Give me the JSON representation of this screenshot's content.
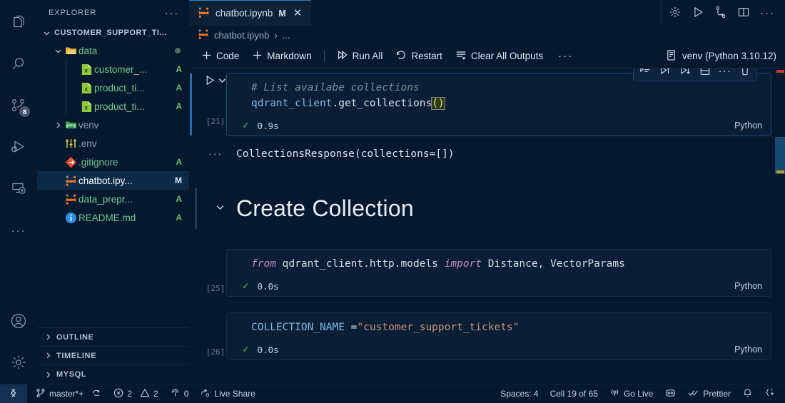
{
  "activitybar": {
    "items": [
      {
        "name": "explorer",
        "icon": "files-icon"
      },
      {
        "name": "search",
        "icon": "search-icon"
      },
      {
        "name": "source-control",
        "icon": "source-control-icon",
        "badge": "8"
      },
      {
        "name": "run-and-debug",
        "icon": "run-debug-icon"
      },
      {
        "name": "remote-explorer",
        "icon": "remote-explorer-icon"
      },
      {
        "name": "additional-views",
        "icon": "ellipsis-icon"
      }
    ],
    "bottom": [
      {
        "name": "accounts",
        "icon": "account-icon"
      },
      {
        "name": "manage",
        "icon": "gear-icon"
      }
    ]
  },
  "sidebar": {
    "title": "EXPLORER",
    "more_label": "···",
    "root_folder": "CUSTOMER_SUPPORT_TI...",
    "tree": [
      {
        "label": "data",
        "type": "folder",
        "indent": 1,
        "expanded": true,
        "status": "",
        "dot": true,
        "color": "green"
      },
      {
        "label": "customer_...",
        "type": "excel",
        "indent": 2,
        "status": "A",
        "color": "green"
      },
      {
        "label": "product_ti...",
        "type": "excel",
        "indent": 2,
        "status": "A",
        "color": "green"
      },
      {
        "label": "product_ti...",
        "type": "excel",
        "indent": 2,
        "status": "A",
        "color": "green"
      },
      {
        "label": "venv",
        "type": "folder",
        "indent": 1,
        "expanded": false,
        "status": "",
        "color": "dim"
      },
      {
        "label": ".env",
        "type": "env",
        "indent": 1,
        "status": "",
        "color": "dim"
      },
      {
        "label": ".gitignore",
        "type": "git",
        "indent": 1,
        "status": "A",
        "color": "green"
      },
      {
        "label": "chatbot.ipy...",
        "type": "notebook",
        "indent": 1,
        "status": "M",
        "color": "sel",
        "selected": true
      },
      {
        "label": "data_prepr...",
        "type": "notebook",
        "indent": 1,
        "status": "A",
        "color": "green"
      },
      {
        "label": "README.md",
        "type": "info",
        "indent": 1,
        "status": "A",
        "color": "green"
      }
    ],
    "sections": [
      {
        "label": "OUTLINE"
      },
      {
        "label": "TIMELINE"
      },
      {
        "label": "MYSQL"
      }
    ]
  },
  "editor": {
    "tab": {
      "title": "chatbot.ipynb",
      "dirty_marker": "M",
      "close": "✕",
      "icon": "jupyter-notebook-icon"
    },
    "tab_actions": [
      {
        "name": "settings-gear-icon"
      },
      {
        "name": "run-icon"
      },
      {
        "name": "compare-changes-icon"
      },
      {
        "name": "split-editor-icon"
      },
      {
        "name": "more-actions-icon",
        "label": "···"
      }
    ],
    "breadcrumbs": {
      "file": "chatbot.ipynb",
      "separator": "›",
      "more": "..."
    },
    "toolbar": {
      "code_label": "Code",
      "markdown_label": "Markdown",
      "run_all_label": "Run All",
      "restart_label": "Restart",
      "clear_all_outputs_label": "Clear All Outputs",
      "more_label": "···",
      "kernel_label": "venv (Python 3.10.12)"
    },
    "cell_toolbar": [
      {
        "name": "run-by-line-icon"
      },
      {
        "name": "execute-above-cells-icon"
      },
      {
        "name": "execute-cell-and-below-icon"
      },
      {
        "name": "split-cell-icon"
      },
      {
        "name": "more-actions-icon",
        "label": "···"
      },
      {
        "name": "delete-cell-icon"
      }
    ],
    "cells": [
      {
        "kind": "code",
        "exec_count": "[21]",
        "duration": "0.9s",
        "language": "Python",
        "status_icon": "success-check",
        "lines": [
          {
            "text": "# List availabe collections",
            "style": "comment"
          },
          {
            "text": "qdrant_client.get_collections()",
            "style": "call"
          }
        ],
        "output": "CollectionsResponse(collections=[])",
        "output_dots": "···"
      },
      {
        "kind": "markdown",
        "heading": "Create Collection",
        "twisty": "⌄"
      },
      {
        "kind": "code",
        "exec_count": "[25]",
        "duration": "0.0s",
        "language": "Python",
        "status_icon": "success-check",
        "lines": [
          {
            "text": "from qdrant_client.http.models import Distance, VectorParams",
            "style": "import"
          }
        ]
      },
      {
        "kind": "code",
        "exec_count": "[26]",
        "duration": "0.0s",
        "language": "Python",
        "status_icon": "success-check",
        "lines": [
          {
            "text": "COLLECTION_NAME =\"customer_support_tickets\"",
            "style": "assign"
          }
        ]
      }
    ],
    "code_tokens": {
      "cell0_comment": "# List availabe collections",
      "cell0_obj": "qdrant_client",
      "cell0_dot": ".",
      "cell0_fn": "get_collections",
      "cell0_brackets": "()",
      "cell2_from": "from",
      "cell2_module": " qdrant_client.http.models ",
      "cell2_import": "import",
      "cell2_names": " Distance, VectorParams",
      "cell3_var": "COLLECTION_NAME",
      "cell3_eq": " =",
      "cell3_str": "\"customer_support_tickets\""
    }
  },
  "statusbar": {
    "remote_icon": "remote-window-icon",
    "branch": "master*+",
    "sync_icon": "sync-changes-icon",
    "errors": "2",
    "warnings": "2",
    "ports": "0",
    "live_share": "Live Share",
    "spaces": "Spaces: 4",
    "cell_position": "Cell 19 of 65",
    "go_live": "Go Live",
    "prettier": "Prettier",
    "notifications_icon": "bell-icon",
    "braces_icon": "braces-icon"
  },
  "colors": {
    "background": "#04182e",
    "cell_background": "#0a1f35",
    "accent_blue": "#2b6cb0",
    "tab_active_border": "#3b7fbf",
    "green_status": "#6db76d",
    "string_orange": "#ce9178",
    "keyword_purple": "#c586c0",
    "variable_blue": "#7fb8e6",
    "comment_gray": "#7f8c99"
  }
}
